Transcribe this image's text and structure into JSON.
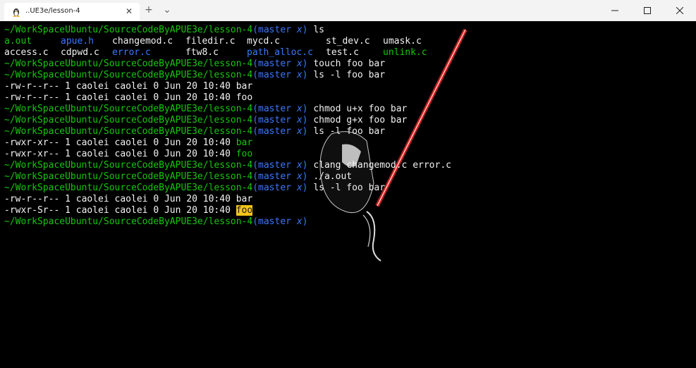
{
  "tab": {
    "title": "..UE3e/lesson-4",
    "close_glyph": "✕"
  },
  "titlebar": {
    "new_tab_glyph": "+",
    "dropdown_glyph": "⌄"
  },
  "prompt": {
    "path": "~/WorkSpaceUbuntu/SourceCodeByAPUE3e/lesson-4",
    "branch_open": "(master ",
    "branch_x": "x",
    "branch_close": ")"
  },
  "terminal": {
    "cmd1": "ls",
    "ls_row1": [
      {
        "name": "a.out",
        "color": "green"
      },
      {
        "name": "apue.h",
        "color": "blue"
      },
      {
        "name": "changemod.c",
        "color": "white"
      },
      {
        "name": "filedir.c",
        "color": "white"
      },
      {
        "name": "mycd.c",
        "color": "white"
      },
      {
        "name": "st_dev.c",
        "color": "white"
      },
      {
        "name": "umask.c",
        "color": "white"
      }
    ],
    "ls_row2": [
      {
        "name": "access.c",
        "color": "white"
      },
      {
        "name": "cdpwd.c",
        "color": "white"
      },
      {
        "name": "error.c",
        "color": "blue"
      },
      {
        "name": "ftw8.c",
        "color": "white"
      },
      {
        "name": "path_alloc.c",
        "color": "blue"
      },
      {
        "name": "test.c",
        "color": "white"
      },
      {
        "name": "unlink.c",
        "color": "green"
      }
    ],
    "cmd2": "touch foo bar",
    "cmd3": "ls -l foo bar",
    "out3a_meta": "-rw-r--r-- 1 caolei caolei 0 Jun 20 10:40 ",
    "out3a_name": "bar",
    "out3b_meta": "-rw-r--r-- 1 caolei caolei 0 Jun 20 10:40 ",
    "out3b_name": "foo",
    "cmd4": "chmod u+x foo bar",
    "cmd5": "chmod g+x foo bar",
    "cmd6": "ls -l foo bar",
    "out6a_meta": "-rwxr-xr-- 1 caolei caolei 0 Jun 20 10:40 ",
    "out6a_name": "bar",
    "out6b_meta": "-rwxr-xr-- 1 caolei caolei 0 Jun 20 10:40 ",
    "out6b_name": "foo",
    "cmd7": "clang changemod.c error.c",
    "cmd8": "./a.out",
    "cmd9": "ls -l foo bar",
    "out9a_meta": "-rw-r--r-- 1 caolei caolei 0 Jun 20 10:40 ",
    "out9a_name": "bar",
    "out9b_meta": "-rwxr-Sr-- 1 caolei caolei 0 Jun 20 10:40 ",
    "out9b_name": "foo"
  },
  "colors": {
    "green": "#16c60c",
    "blue": "#3b78ff",
    "white": "#f2f2f2",
    "highlight": "#f5c518",
    "saber": "#ff1a1a"
  }
}
